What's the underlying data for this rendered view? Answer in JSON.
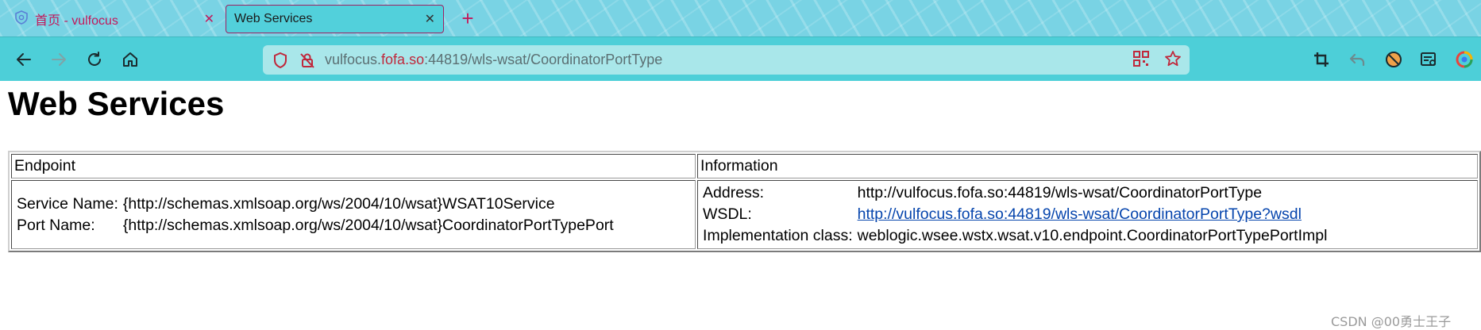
{
  "tabs": [
    {
      "label": "首页 - vulfocus",
      "active": false
    },
    {
      "label": "Web Services",
      "active": true
    }
  ],
  "new_tab_label": "+",
  "url": {
    "domain_before": "vulfocus.",
    "domain": "fofa.so",
    "rest": ":44819/wls-wsat/CoordinatorPortType"
  },
  "page": {
    "title": "Web Services",
    "table": {
      "headers": [
        "Endpoint",
        "Information"
      ],
      "endpoint": {
        "service_name_label": "Service Name:",
        "service_name_value": "{http://schemas.xmlsoap.org/ws/2004/10/wsat}WSAT10Service",
        "port_name_label": "Port Name:",
        "port_name_value": "{http://schemas.xmlsoap.org/ws/2004/10/wsat}CoordinatorPortTypePort"
      },
      "information": {
        "address_label": "Address:",
        "address_value": "http://vulfocus.fofa.so:44819/wls-wsat/CoordinatorPortType",
        "wsdl_label": "WSDL:",
        "wsdl_value": "http://vulfocus.fofa.so:44819/wls-wsat/CoordinatorPortType?wsdl",
        "impl_label": "Implementation class:",
        "impl_value": "weblogic.wsee.wstx.wsat.v10.endpoint.CoordinatorPortTypePortImpl"
      }
    }
  },
  "watermark": "CSDN @00勇士王子",
  "colors": {
    "accent": "#4dcfd8",
    "tab_text": "#c2185b",
    "url_domain": "#c0283b",
    "link": "#0645ad"
  }
}
